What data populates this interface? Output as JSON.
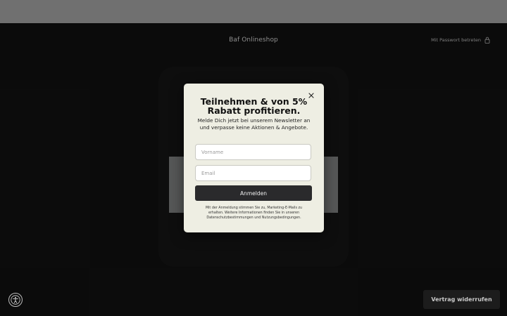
{
  "header": {
    "shop_name": "Baf Onlineshop",
    "password_link": "Mit Passwort betreten"
  },
  "popup": {
    "title": "Teilnehmen & von 5% Rabatt profitieren.",
    "subtitle": "Melde Dich jetzt bei unserem Newsletter an und verpasse keine Aktionen & Angebote.",
    "firstname_placeholder": "Vorname",
    "email_placeholder": "Email",
    "submit_label": "Anmelden",
    "legal_text": "Mit der Anmeldung stimmen Sie zu, Marketing-E-Mails zu erhalten. Weitere Informationen finden Sie in unseren Datenschutzbestimmungen und Nutzungsbedingungen."
  },
  "footer": {
    "withdraw_label": "Vertrag widerrufen"
  },
  "icons": {
    "close": "close-icon",
    "lock": "lock-icon",
    "accessibility": "accessibility-icon"
  },
  "colors": {
    "popup_bg": "#eeeee3",
    "button_bg": "#2a2a2c",
    "page_bg": "#0d0d0d",
    "topbar_bg": "#7a7a7a"
  }
}
